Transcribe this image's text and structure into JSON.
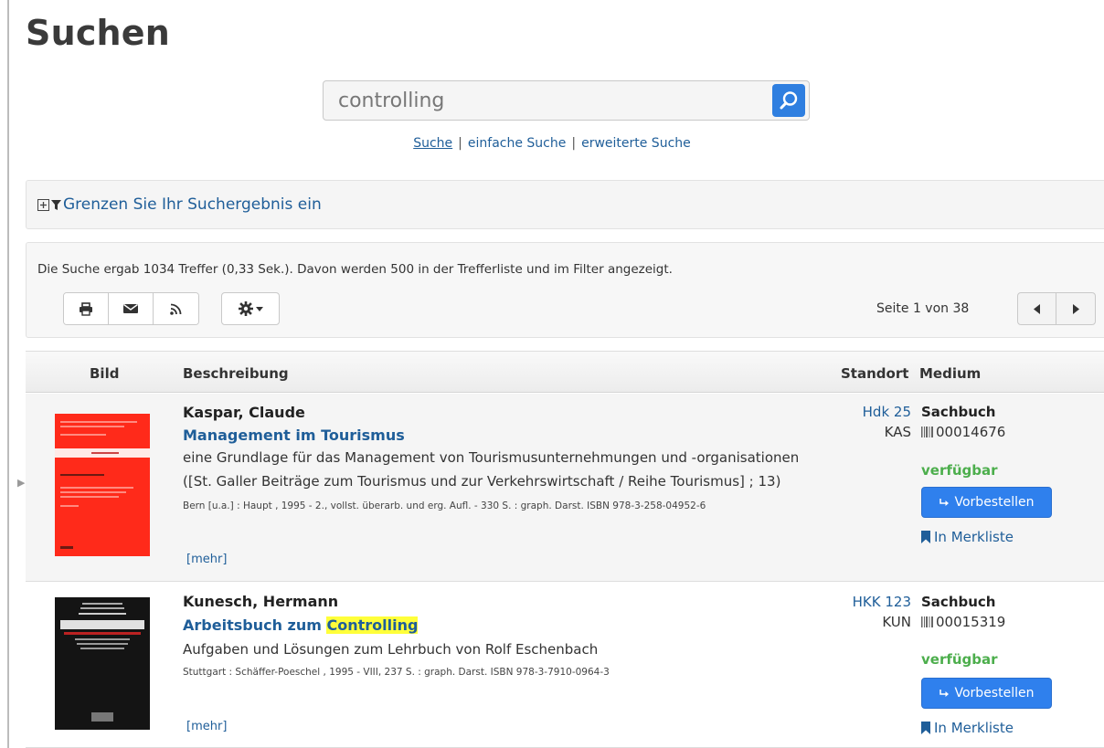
{
  "page": {
    "title": "Suchen"
  },
  "search": {
    "value": "controlling",
    "links": [
      "Suche",
      "einfache Suche",
      "erweiterte Suche"
    ],
    "separator": "|"
  },
  "filter": {
    "label": "Grenzen Sie Ihr Suchergebnis ein"
  },
  "results": {
    "summary": "Die Suche ergab 1034 Treffer (0,33 Sek.). Davon werden 500 in der Trefferliste und im Filter angezeigt.",
    "page_info": "Seite 1 von 38"
  },
  "table": {
    "headers": {
      "bild": "Bild",
      "beschreibung": "Beschreibung",
      "standort": "Standort",
      "medium": "Medium"
    }
  },
  "items": [
    {
      "author": "Kaspar, Claude",
      "title": "Management im Tourismus",
      "subtitle": "eine Grundlage für das Management von Tourismusunternehmungen und -organisationen",
      "series": "([St. Galler Beiträge zum Tourismus und zur Verkehrswirtschaft / Reihe Tourismus] ; 13)",
      "imprint": "Bern [u.a.] : Haupt , 1995 - 2., vollst. überarb. und erg. Aufl. - 330 S. : graph. Darst. ISBN 978-3-258-04952-6",
      "more": "[mehr]",
      "location": "Hdk 25",
      "signature": "KAS",
      "medium": "Sachbuch",
      "barcode": "00014676",
      "status": "verfügbar",
      "order_label": "Vorbestellen",
      "watchlist_label": "In Merkliste",
      "cover_color": "#ff2a1a"
    },
    {
      "author": "Kunesch, Hermann",
      "title_pre": "Arbeitsbuch zum ",
      "title_hl": "Controlling",
      "subtitle": "Aufgaben und Lösungen zum Lehrbuch von Rolf Eschenbach",
      "imprint": "Stuttgart : Schäffer-Poeschel , 1995 - VIII, 237 S. : graph. Darst. ISBN 978-3-7910-0964-3",
      "more": "[mehr]",
      "location": "HKK 123",
      "signature": "KUN",
      "medium": "Sachbuch",
      "barcode": "00015319",
      "status": "verfügbar",
      "order_label": "Vorbestellen",
      "watchlist_label": "In Merkliste",
      "cover_color": "#111111"
    }
  ],
  "colors": {
    "link": "#1f5e99",
    "primary_button": "#2f80ed",
    "available": "#4cae4c",
    "highlight": "#ffff3a"
  }
}
